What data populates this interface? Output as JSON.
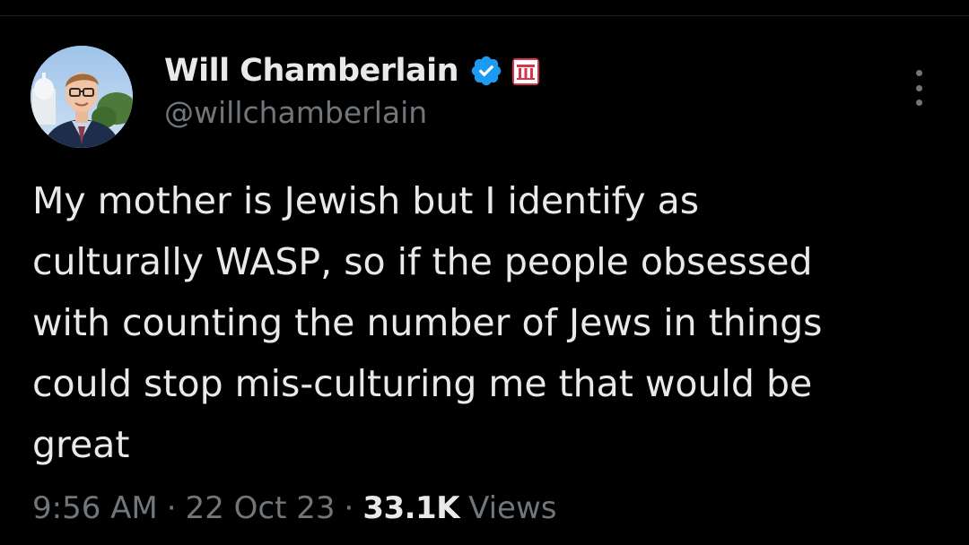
{
  "author": {
    "display_name": "Will Chamberlain",
    "handle": "@willchamberlain",
    "verified": true,
    "badges": [
      "verified-check-icon",
      "affiliate-badge-icon"
    ]
  },
  "tweet": {
    "text_lines": [
      "My mother is Jewish but I identify as",
      "culturally WASP, so if the people obsessed",
      "with counting the number of Jews in things",
      "could stop mis-culturing me that would be",
      "great"
    ]
  },
  "meta": {
    "time": "9:56 AM",
    "separator": "·",
    "date": "22 Oct 23",
    "views_count": "33.1K",
    "views_label": "Views"
  },
  "colors": {
    "background": "#000000",
    "text_primary": "#e7e9ea",
    "text_secondary": "#71767b",
    "verified_blue": "#1d9bf0",
    "affiliate_red": "#d7354a"
  },
  "icons": {
    "more": "more-options-icon"
  }
}
